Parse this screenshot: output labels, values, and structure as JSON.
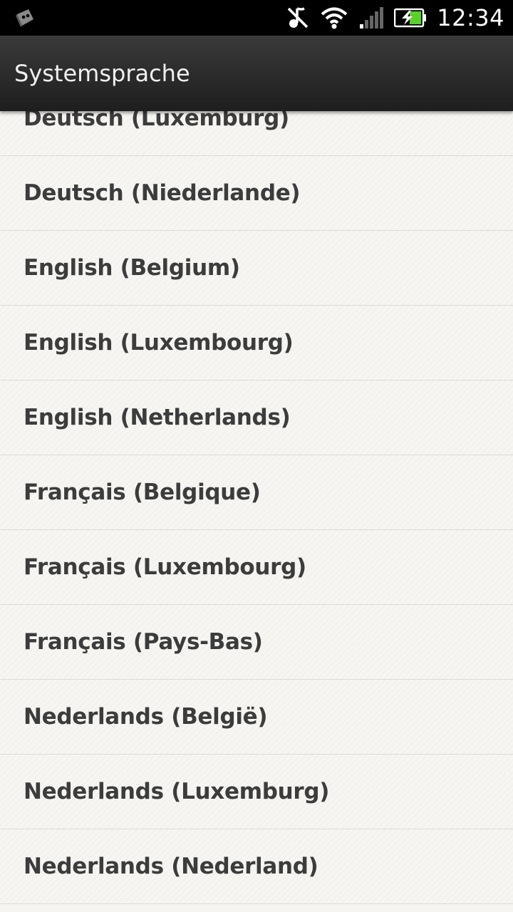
{
  "status_bar": {
    "time": "12:34",
    "icons": [
      "htc-notification-icon",
      "mute-icon",
      "wifi-icon",
      "signal-icon",
      "battery-charging-icon"
    ]
  },
  "action_bar": {
    "title": "Systemsprache"
  },
  "languages": [
    "Deutsch (Luxemburg)",
    "Deutsch (Niederlande)",
    "English (Belgium)",
    "English (Luxembourg)",
    "English (Netherlands)",
    "Français (Belgique)",
    "Français (Luxembourg)",
    "Français (Pays-Bas)",
    "Nederlands (België)",
    "Nederlands (Luxemburg)",
    "Nederlands (Nederland)"
  ],
  "colors": {
    "status_bar": "#000000",
    "action_bar": "#2a2a2a",
    "list_background": "#f5f4f1",
    "item_text": "#3c3c3c",
    "battery_green": "#5bd12b"
  }
}
